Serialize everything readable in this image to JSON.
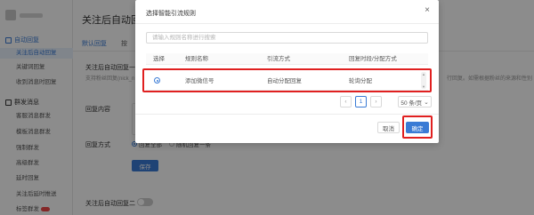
{
  "sidebar": {
    "group1": "自动回复",
    "items1": [
      "关注后自动回复",
      "关键词回复",
      "收到消息时回复"
    ],
    "group2": "群发消息",
    "items2": [
      "客服消息群发",
      "模板消息群发",
      "强制群发",
      "高级群发",
      "延时回复",
      "关注后延时推送",
      "标签群发"
    ]
  },
  "main": {
    "title": "关注后自动回复",
    "tabs": [
      "默认回复",
      "按"
    ],
    "section_title": "关注后自动回复一",
    "section_desc": "支持粉丝回复(nick_n",
    "right_note": "行回复。如需根据粉丝的来源和性别",
    "content_label": "回复内容",
    "mode_label": "回复方式",
    "mode_options": [
      "回复全部",
      "随机回复一条"
    ],
    "save_label": "保存",
    "section2_title": "关注后自动回复二"
  },
  "modal": {
    "title": "选择智能引流规则",
    "close": "×",
    "search_placeholder": "请输入规则名称进行搜索",
    "columns": [
      "选择",
      "规则名称",
      "引流方式",
      "回复时段/分配方式"
    ],
    "rows": [
      {
        "name": "添加微信号",
        "method": "自动分配回复",
        "allocation": "轮询分配"
      }
    ],
    "pager": {
      "prev": "‹",
      "page": "1",
      "next": "›",
      "page_size": "50 条/页"
    },
    "cancel_label": "取消",
    "confirm_label": "确定"
  },
  "colors": {
    "accent": "#3a7bd5",
    "highlight": "#e02020"
  }
}
